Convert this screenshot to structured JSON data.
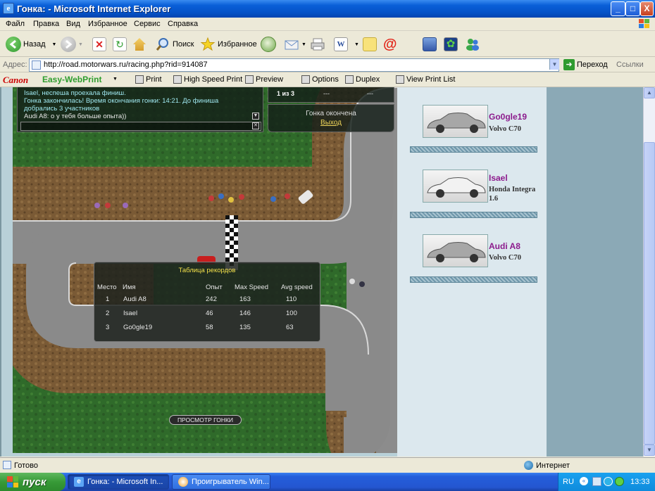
{
  "window": {
    "title": "Гонка: - Microsoft Internet Explorer",
    "minimize": "_",
    "maximize": "□",
    "close": "X"
  },
  "menu": [
    "Файл",
    "Правка",
    "Вид",
    "Избранное",
    "Сервис",
    "Справка"
  ],
  "toolbar": {
    "back": "Назад",
    "search": "Поиск",
    "favorites": "Избранное"
  },
  "address": {
    "label": "Адрес:",
    "url": "http://road.motorwars.ru/racing.php?rid=914087",
    "go": "Переход",
    "links": "Ссылки"
  },
  "canon": {
    "brand": "Canon",
    "product": "Easy-WebPrint",
    "print": "Print",
    "high_speed": "High Speed Print",
    "preview": "Preview",
    "options": "Options",
    "duplex": "Duplex",
    "view_list": "View Print List"
  },
  "chat": {
    "messages": [
      {
        "text": "Isael, неспеша проехала финиш.",
        "color": "#9fe8f0"
      },
      {
        "text": "Гонка закончилась! Время окончания гонки: 14:21. До финиша",
        "color": "#9fe8f0"
      },
      {
        "text": "добрались 3 участников",
        "color": "#9fe8f0"
      },
      {
        "text": "Audi A8: о у тебя больше опыта))",
        "color": "#e8e8e8"
      }
    ],
    "input_value": ""
  },
  "race_status": {
    "lap": "1 из 3",
    "slot2": "---",
    "slot3": "---",
    "finished": "Гонка окончена",
    "exit": "Выход"
  },
  "records": {
    "title": "Таблица рекордов",
    "headers": {
      "place": "Место",
      "name": "Имя",
      "exp": "Опыт",
      "max": "Max Speed",
      "avg": "Avg speed"
    },
    "rows": [
      {
        "place": "1",
        "name": "Audi A8",
        "exp": "242",
        "max": "163",
        "avg": "110"
      },
      {
        "place": "2",
        "name": "Isael",
        "exp": "46",
        "max": "146",
        "avg": "100"
      },
      {
        "place": "3",
        "name": "Go0gle19",
        "exp": "58",
        "max": "135",
        "avg": "63"
      }
    ]
  },
  "replay_button": "ПРОСМОТР ГОНКИ",
  "racers": [
    {
      "name": "Go0gle19",
      "car": "Volvo C70",
      "car_color": "#a7a7a7"
    },
    {
      "name": "Isael",
      "car": "Honda Integra 1.6",
      "car_color": "#f2f2f2"
    },
    {
      "name": "Audi A8",
      "car": "Volvo C70",
      "car_color": "#a7a7a7"
    }
  ],
  "status": {
    "ready": "Готово",
    "zone": "Интернет"
  },
  "taskbar": {
    "start": "пуск",
    "tasks": [
      "Гонка: - Microsoft In...",
      "Проигрыватель Win..."
    ],
    "lang": "RU",
    "clock": "13:33"
  },
  "colors": {
    "accent_title": "#0553C8",
    "racer_name": "#8c1a8c",
    "records_title": "#f2e04a",
    "exit_link": "#f0d65a"
  }
}
